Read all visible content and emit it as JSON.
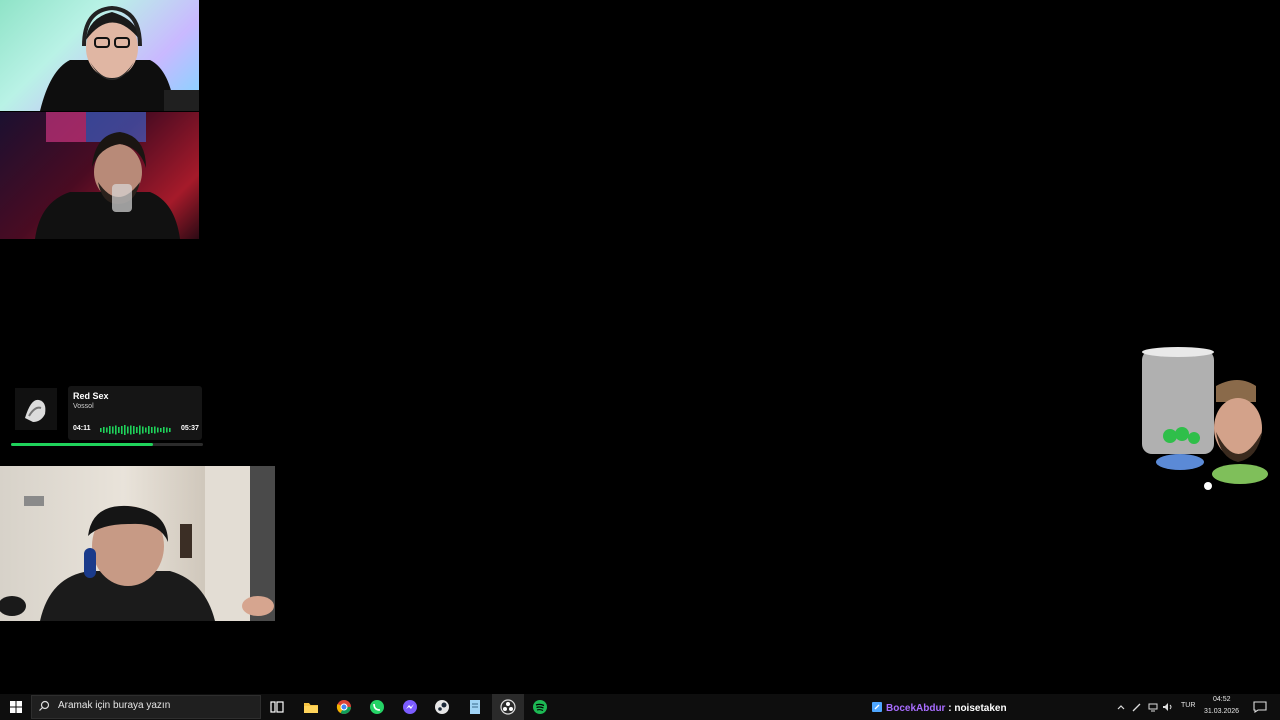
{
  "music": {
    "title": "Red Sex",
    "artist": "Vossol",
    "elapsed": "04:11",
    "duration": "05:37",
    "progress_fraction": 0.74,
    "accent": "#1fd25b"
  },
  "taskbar": {
    "search_placeholder": "Aramak için buraya yazın",
    "apps": [
      "task-view-icon",
      "file-explorer-icon",
      "chrome-icon",
      "whatsapp-icon",
      "messenger-icon",
      "steam-icon",
      "notepad-icon",
      "obs-icon",
      "spotify-icon"
    ],
    "language": "TUR",
    "time": "04:52",
    "date": "31.03.2026"
  },
  "chat": {
    "user": "BocekAbdur",
    "separator": " : ",
    "message": "noisetaken",
    "user_color": "#a86dff"
  }
}
